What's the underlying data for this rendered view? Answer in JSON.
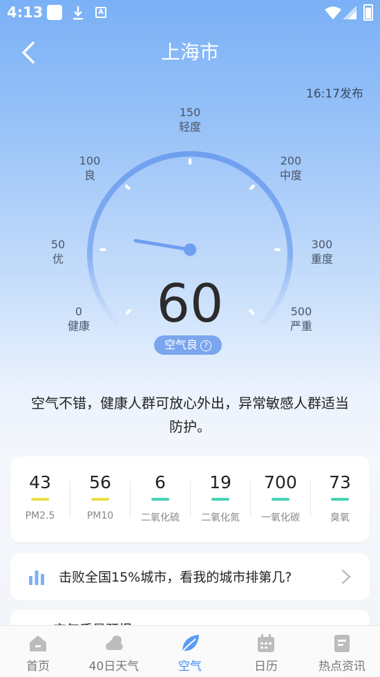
{
  "status_bar": {
    "time": "4:13"
  },
  "header": {
    "title": "上海市"
  },
  "publish_time": "16:17发布",
  "gauge": {
    "labels": [
      {
        "value": "0",
        "text": "健康"
      },
      {
        "value": "50",
        "text": "优"
      },
      {
        "value": "100",
        "text": "良"
      },
      {
        "value": "150",
        "text": "轻度"
      },
      {
        "value": "200",
        "text": "中度"
      },
      {
        "value": "300",
        "text": "重度"
      },
      {
        "value": "500",
        "text": "严重"
      }
    ],
    "aqi": "60",
    "level_label": "空气良",
    "help_icon": "question-icon",
    "accent_color": "#6f9ff0",
    "badge_color": "#7aa6ee"
  },
  "advice": "空气不错，健康人群可放心外出，异常敏感人群适当防护。",
  "pollutants": [
    {
      "value": "43",
      "name": "PM2.5",
      "color": "#e8df4a"
    },
    {
      "value": "56",
      "name": "PM10",
      "color": "#e8df4a"
    },
    {
      "value": "6",
      "name": "二氧化硫",
      "color": "#45d1b5"
    },
    {
      "value": "19",
      "name": "二氧化氮",
      "color": "#45d1b5"
    },
    {
      "value": "700",
      "name": "一氧化碳",
      "color": "#45d1b5"
    },
    {
      "value": "73",
      "name": "臭氧",
      "color": "#45d1b5"
    }
  ],
  "rank": {
    "text": "击败全国15%城市，看我的城市排第几?",
    "icon": "bar-chart-icon"
  },
  "next_card": {
    "title": "空气质量预报"
  },
  "nav": [
    {
      "label": "首页",
      "icon": "home-icon",
      "active": false
    },
    {
      "label": "40日天气",
      "icon": "cloud-icon",
      "active": false
    },
    {
      "label": "空气",
      "icon": "leaf-icon",
      "active": true
    },
    {
      "label": "日历",
      "icon": "calendar-icon",
      "active": false
    },
    {
      "label": "热点资讯",
      "icon": "news-icon",
      "active": false
    }
  ]
}
